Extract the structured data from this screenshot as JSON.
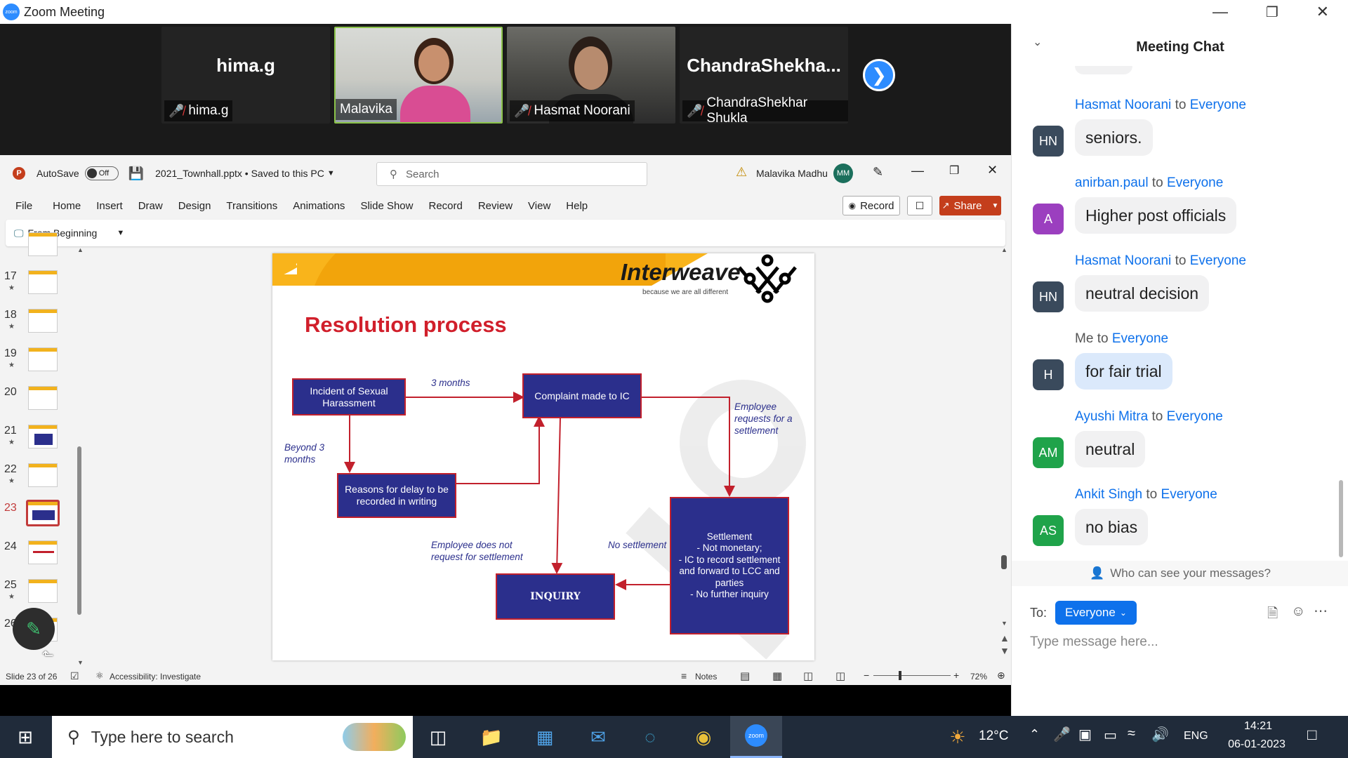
{
  "zoom": {
    "title": "Zoom Meeting",
    "logo_text": "zoom"
  },
  "participants": [
    {
      "name": "hima.g",
      "big": "hima.g",
      "muted": true
    },
    {
      "name": "Malavika",
      "muted": false
    },
    {
      "name": "Hasmat Noorani",
      "muted": true
    },
    {
      "name": "ChandraShekhar Shukla",
      "big": "ChandraShekha...",
      "muted": true
    }
  ],
  "ppt": {
    "autosave": "AutoSave",
    "autosave_state": "Off",
    "filename": "2021_Townhall.pptx • Saved to this PC",
    "search_placeholder": "Search",
    "user": "Malavika Madhu",
    "user_initials": "MM",
    "menu": [
      "File",
      "Home",
      "Insert",
      "Draw",
      "Design",
      "Transitions",
      "Animations",
      "Slide Show",
      "Record",
      "Review",
      "View",
      "Help"
    ],
    "record_btn": "Record",
    "share_btn": "Share",
    "from_beginning": "From Beginning",
    "thumbs": [
      "17",
      "18",
      "19",
      "20",
      "21",
      "22",
      "23",
      "24",
      "25",
      "26"
    ],
    "selected_slide": "23",
    "status": {
      "slide": "Slide 23 of 26",
      "accessibility": "Accessibility: Investigate",
      "notes": "Notes",
      "zoom": "72%"
    }
  },
  "slide": {
    "brand": "Interweave",
    "tagline": "because we are all different",
    "title": "Resolution process",
    "boxes": {
      "incident": "Incident of Sexual Harassment",
      "complaint": "Complaint made to IC",
      "reasons": "Reasons for delay to be recorded in writing",
      "inquiry": "INQUIRY",
      "settlement_title": "Settlement",
      "settlement_items": [
        "-    Not monetary;",
        "-    IC to record settlement and forward to LCC and parties",
        "-    No further inquiry"
      ]
    },
    "labels": {
      "three_months": "3 months",
      "beyond": "Beyond 3 months",
      "employee_requests": "Employee requests for a settlement",
      "no_request": "Employee does not request for settlement",
      "no_settlement": "No settlement"
    }
  },
  "chat": {
    "title": "Meeting Chat",
    "messages": [
      {
        "from": "Hasmat Noorani",
        "to": "Everyone",
        "initials": "HN",
        "color": "#3a4a5c",
        "text": "seniors."
      },
      {
        "from": "anirban.paul",
        "to": "Everyone",
        "initials": "A",
        "color": "#9b3fbf",
        "text": "Higher post officials"
      },
      {
        "from": "Hasmat Noorani",
        "to": "Everyone",
        "initials": "HN",
        "color": "#3a4a5c",
        "text": "neutral decision"
      },
      {
        "from": "Me",
        "to": "Everyone",
        "initials": "H",
        "color": "#3a4a5c",
        "text": "for fair trial",
        "self": true
      },
      {
        "from": "Ayushi Mitra",
        "to": "Everyone",
        "initials": "AM",
        "color": "#1fa34a",
        "text": "neutral"
      },
      {
        "from": "Ankit Singh",
        "to": "Everyone",
        "initials": "AS",
        "color": "#1fa34a",
        "text": "no bias"
      }
    ],
    "to_word": "to",
    "who_can_see": "Who can see your messages?",
    "to_label": "To:",
    "recipient": "Everyone",
    "placeholder": "Type message here..."
  },
  "taskbar": {
    "search_placeholder": "Type here to search",
    "temperature": "12°C",
    "lang": "ENG",
    "time": "14:21",
    "date": "06-01-2023"
  }
}
